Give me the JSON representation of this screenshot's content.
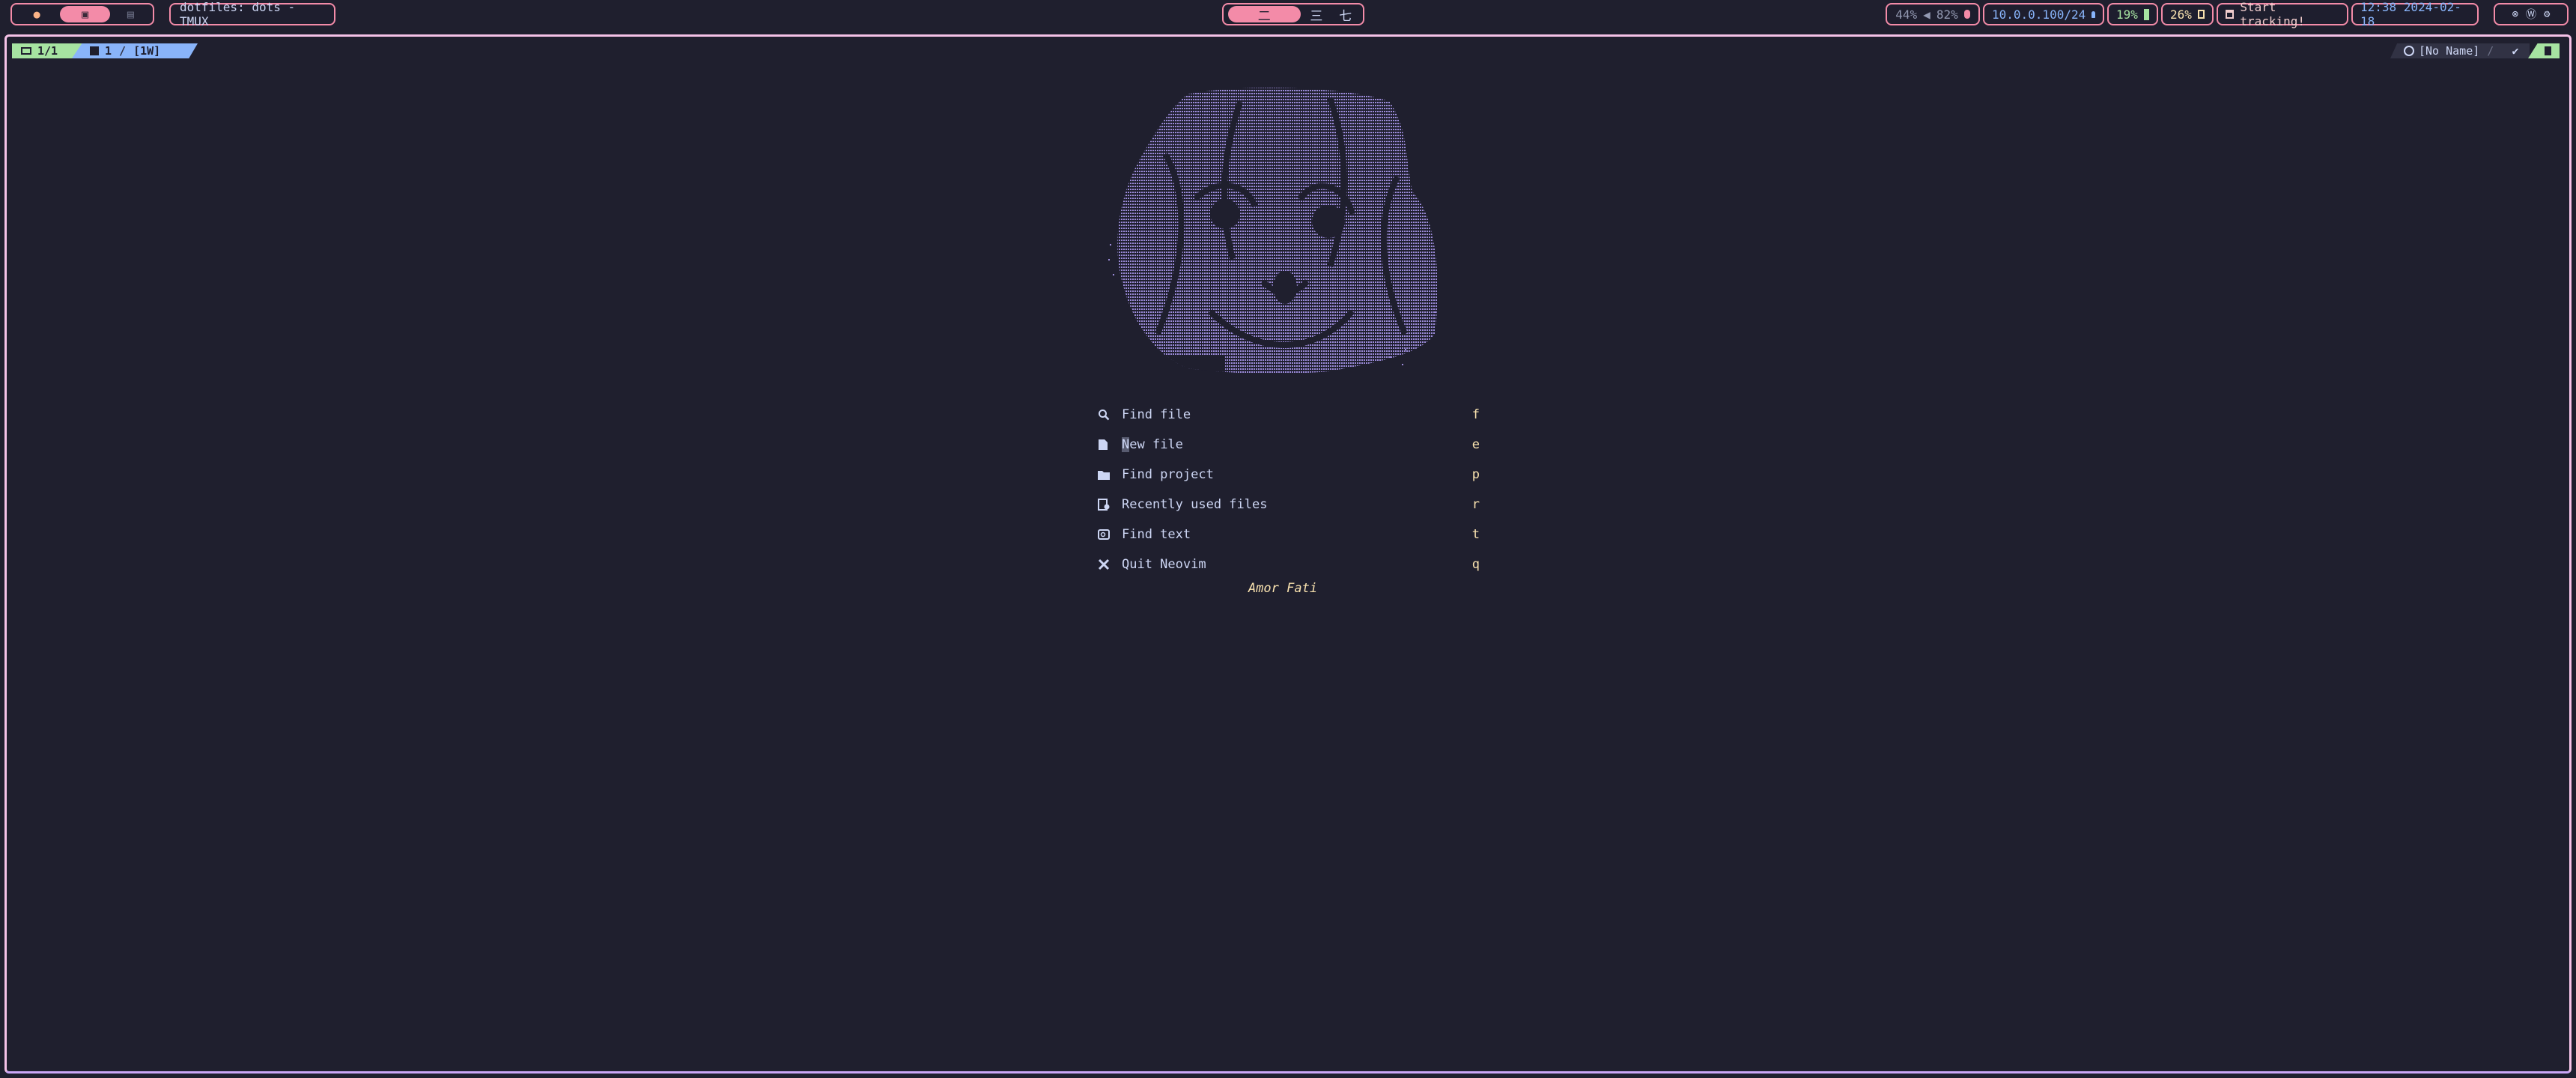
{
  "topbar": {
    "workspaces_left": [
      "",
      "",
      ""
    ],
    "window_title": "dotfiles: dots - TMUX",
    "workspaces_center": [
      "二",
      "三",
      "七"
    ],
    "volume": "44%",
    "mic": "82%",
    "network": "10.0.0.100/24",
    "battery": "19%",
    "cpu": "26%",
    "tracking": "Start tracking!",
    "clock": "12:38 2024-02-18",
    "tray_icons": [
      "⊗",
      "Ⓦ",
      "⚙"
    ]
  },
  "tabline": {
    "session": "1/1",
    "window_index": "1",
    "window_name": "[1W]",
    "buffer_name": "[No Name]",
    "modified_icon": "✔"
  },
  "dashboard": {
    "items": [
      {
        "icon": "search-icon",
        "label": "Find file",
        "key": "f"
      },
      {
        "icon": "file-icon",
        "label": "New file",
        "key": "e"
      },
      {
        "icon": "folder-icon",
        "label": "Find project",
        "key": "p"
      },
      {
        "icon": "history-icon",
        "label": "Recently used files",
        "key": "r"
      },
      {
        "icon": "text-search-icon",
        "label": "Find text",
        "key": "t"
      },
      {
        "icon": "close-icon",
        "label": "Quit Neovim",
        "key": "q"
      }
    ],
    "footer": "Amor Fati"
  },
  "colors": {
    "background": "#1f1f2e",
    "accent_pink": "#f38ba8",
    "art_purple": "#9b8bd9",
    "key_yellow": "#f9e2af"
  }
}
